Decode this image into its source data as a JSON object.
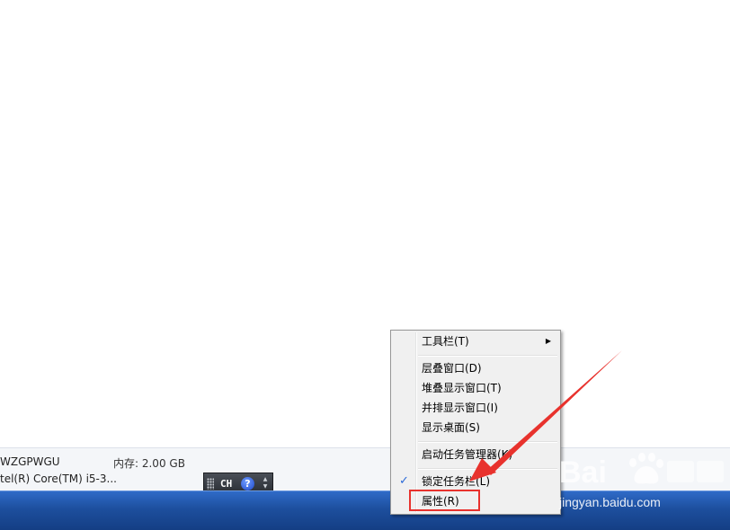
{
  "sysinfo": {
    "pc_name": "WZGPWGU",
    "memory_label": "内存: 2.00 GB",
    "cpu": "tel(R) Core(TM) i5-3..."
  },
  "language_bar": {
    "language": "CH",
    "help_glyph": "?"
  },
  "context_menu": {
    "items": [
      {
        "label": "工具栏(T)",
        "has_submenu": true
      },
      {
        "label": "层叠窗口(D)"
      },
      {
        "label": "堆叠显示窗口(T)"
      },
      {
        "label": "并排显示窗口(I)"
      },
      {
        "label": "显示桌面(S)"
      },
      {
        "label": "启动任务管理器(K)"
      },
      {
        "label": "锁定任务栏(L)",
        "checked": true
      },
      {
        "label": "属性(R)",
        "highlighted": true
      }
    ]
  },
  "watermark": {
    "site": "jingyan.baidu.com"
  },
  "colors": {
    "taskbar": "#1d4f9e",
    "highlight": "#e8322d",
    "check": "#2b6ad8",
    "menu_bg": "#f0f0f0"
  }
}
